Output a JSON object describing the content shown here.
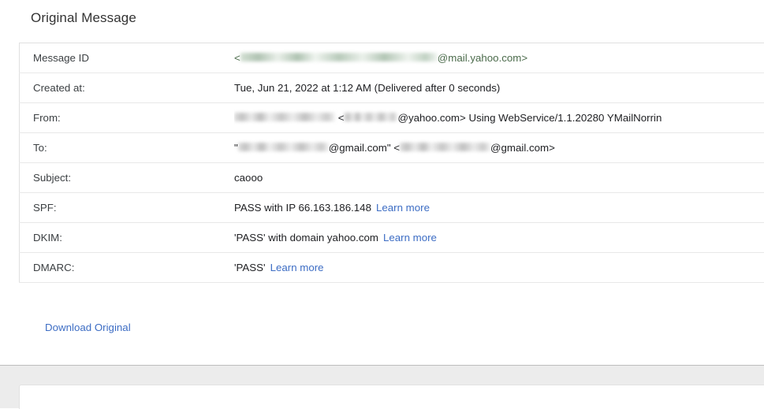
{
  "header": {
    "title": "Original Message"
  },
  "details": {
    "rows": [
      {
        "label": "Message ID",
        "prefix": "<",
        "redacted": true,
        "redacted_width": 250,
        "redacted_style": "green",
        "value": "@mail.yahoo.com>",
        "value_style": "msgid",
        "suffix": "",
        "link": ""
      },
      {
        "label": "Created at:",
        "prefix": "",
        "redacted": false,
        "redacted_width": 0,
        "redacted_style": "",
        "value": "Tue, Jun 21, 2022 at 1:12 AM (Delivered after 0 seconds)",
        "value_style": "plain",
        "suffix": "",
        "link": ""
      },
      {
        "label": "From:",
        "prefix": "",
        "redacted": true,
        "redacted_width": 128,
        "redacted_style": "gray",
        "value": "",
        "value_style": "plain",
        "suffix": "",
        "link": ""
      },
      {
        "label": "To:",
        "prefix": "\"",
        "redacted": true,
        "redacted_width": 115,
        "redacted_style": "gray",
        "value": "@gmail.com\" <",
        "value_style": "plain",
        "suffix": "@gmail.com>",
        "link": ""
      },
      {
        "label": "Subject:",
        "prefix": "",
        "redacted": false,
        "redacted_width": 0,
        "redacted_style": "",
        "value": "caooo",
        "value_style": "plain",
        "suffix": "",
        "link": ""
      },
      {
        "label": "SPF:",
        "prefix": "",
        "redacted": false,
        "redacted_width": 0,
        "redacted_style": "",
        "value": "PASS with IP 66.163.186.148",
        "value_style": "plain",
        "suffix": "",
        "link": "Learn more"
      },
      {
        "label": "DKIM:",
        "prefix": "",
        "redacted": false,
        "redacted_width": 0,
        "redacted_style": "",
        "value": "'PASS' with domain yahoo.com",
        "value_style": "plain",
        "suffix": "",
        "link": "Learn more"
      },
      {
        "label": "DMARC:",
        "prefix": "",
        "redacted": false,
        "redacted_width": 0,
        "redacted_style": "",
        "value": "'PASS'",
        "value_style": "plain",
        "suffix": "",
        "link": "Learn more"
      }
    ],
    "from_row": {
      "mid_text": " <",
      "tail_text": "@yahoo.com> Using WebService/1.1.20280 YMailNorrin",
      "redacted2_width": 68
    },
    "to_row": {
      "redacted2_width": 115
    }
  },
  "actions": {
    "download_original": "Download Original"
  },
  "colors": {
    "link": "#3d6dc4",
    "message_id_text": "#4b6b4b",
    "body_text": "#202124",
    "panel_bg": "#ffffff",
    "lower_bg": "#ececec",
    "row_border": "#e8e8e8"
  }
}
